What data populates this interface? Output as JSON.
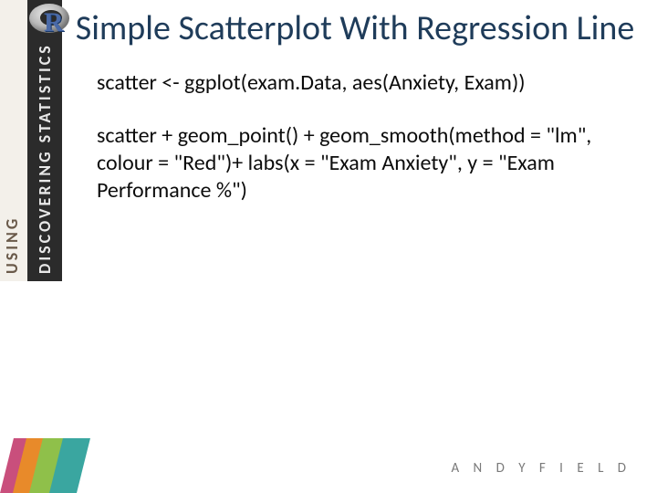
{
  "sidebar": {
    "text_using": "USING",
    "text_discovering": "DISCOVERING STATISTICS",
    "r_letter": "R"
  },
  "title": "Simple Scatterplot With Regression Line",
  "code": {
    "line1": "scatter <- ggplot(exam.Data, aes(Anxiety, Exam))",
    "line2": "scatter + geom_point() + geom_smooth(method = \"lm\", colour = \"Red\")+ labs(x = \"Exam Anxiety\", y = \"Exam Performance %\")"
  },
  "footer": {
    "author": "A N D Y   F I E L D"
  }
}
